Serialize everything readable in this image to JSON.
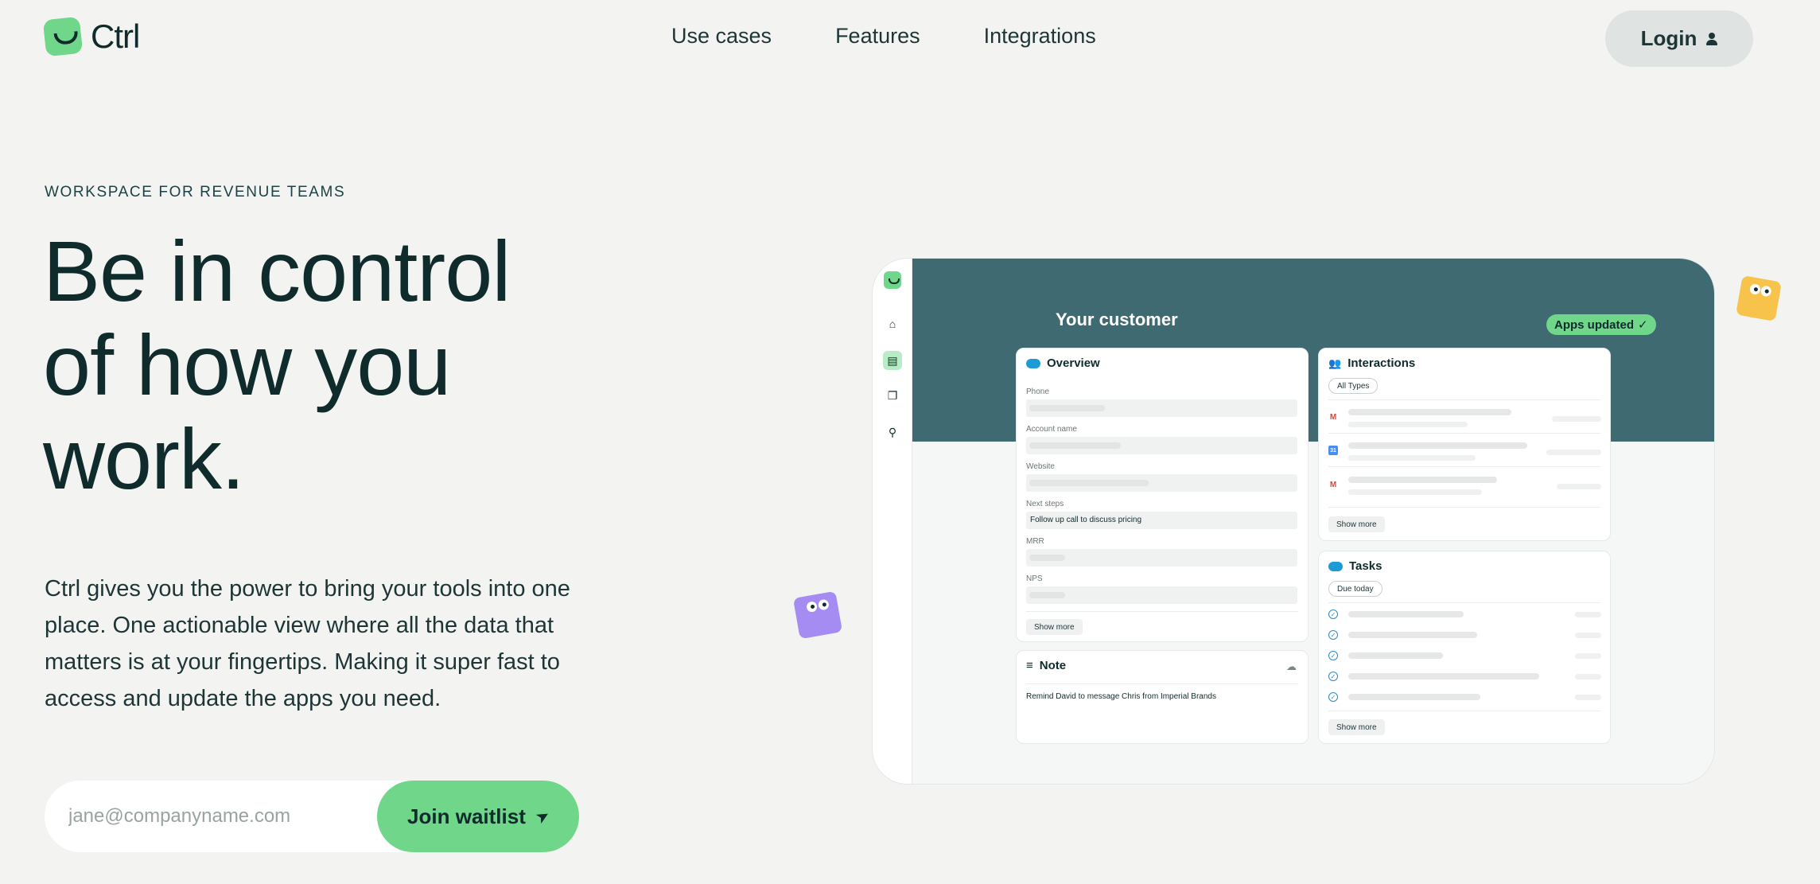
{
  "nav": {
    "logo_text": "Ctrl",
    "links": [
      "Use cases",
      "Features",
      "Integrations"
    ],
    "login_label": "Login"
  },
  "hero": {
    "eyebrow": "WORKSPACE FOR REVENUE TEAMS",
    "headline_lines": [
      "Be in control",
      "of how you",
      "work."
    ],
    "body": "Ctrl gives you the power to bring your tools into one place. One actionable view where all the data that matters is at your fingertips. Making it super fast to access and update the apps you need.",
    "email_placeholder": "jane@companyname.com",
    "cta_label": "Join waitlist"
  },
  "preview": {
    "title": "Your customer",
    "apps_updated": "Apps updated",
    "overview": {
      "title": "Overview",
      "fields": [
        {
          "label": "Phone",
          "value": ""
        },
        {
          "label": "Account name",
          "value": ""
        },
        {
          "label": "Website",
          "value": ""
        },
        {
          "label": "Next steps",
          "value": "Follow up call to discuss pricing"
        },
        {
          "label": "MRR",
          "value": ""
        },
        {
          "label": "NPS",
          "value": ""
        }
      ],
      "show_more": "Show more"
    },
    "interactions": {
      "title": "Interactions",
      "filter": "All Types",
      "show_more": "Show more"
    },
    "tasks": {
      "title": "Tasks",
      "filter": "Due today",
      "show_more": "Show more"
    },
    "note": {
      "title": "Note",
      "text": "Remind David to message Chris from Imperial Brands"
    }
  },
  "colors": {
    "background": "#f3f4f2",
    "accent_green": "#6fd68a",
    "header_teal": "#406a71",
    "text_dark": "#0f2b2c",
    "mascot_purple": "#a58cf2",
    "mascot_yellow": "#f7c34a"
  },
  "icons": [
    "logo-icon",
    "user-icon",
    "send-icon",
    "home-icon",
    "cards-icon",
    "stack-icon",
    "search-icon",
    "salesforce-icon",
    "people-icon",
    "gmail-icon",
    "calendar-icon",
    "check-circle-icon",
    "lines-icon",
    "cloud-icon"
  ]
}
